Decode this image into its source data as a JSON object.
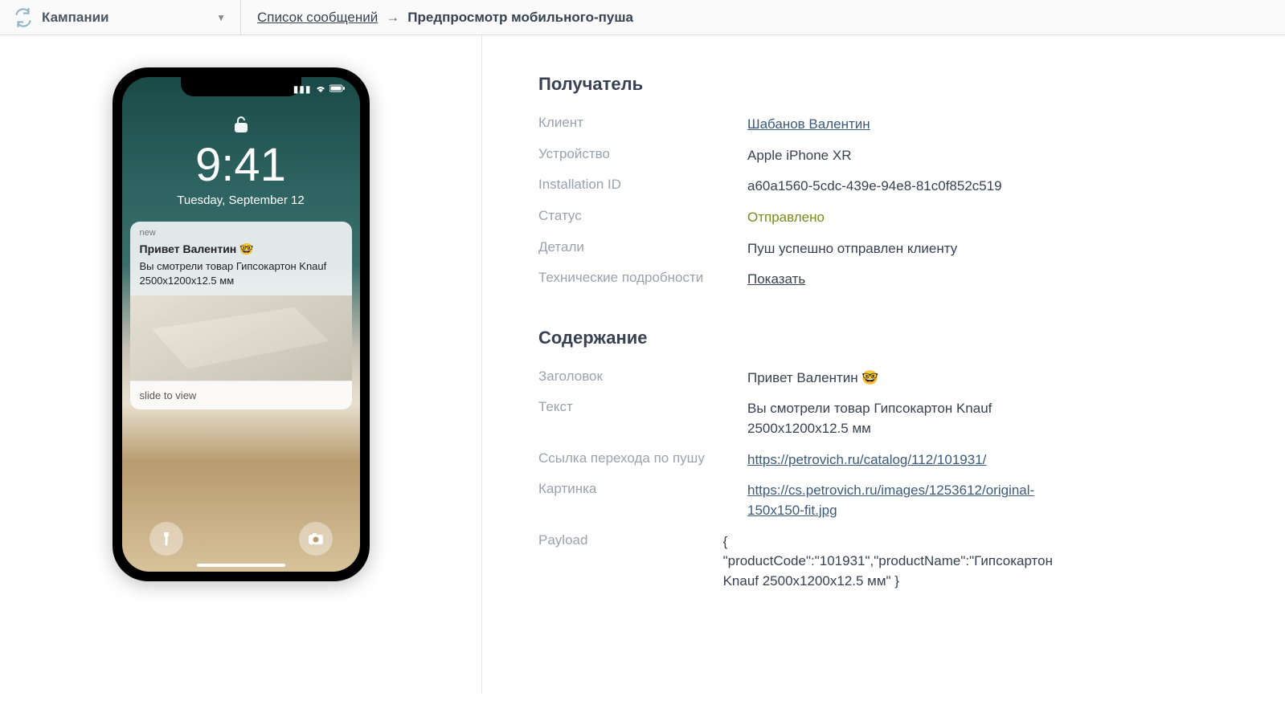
{
  "nav": {
    "brand": "Кампании",
    "breadcrumb_link": "Список сообщений",
    "breadcrumb_active": "Предпросмотр мобильного-пуша"
  },
  "phone": {
    "time": "9:41",
    "date": "Tuesday, September 12",
    "notif_app": "new",
    "notif_title": "Привет Валентин 🤓",
    "notif_body": "Вы смотрели товар Гипсокартон Knauf 2500х1200х12.5 мм",
    "slide": "slide to view"
  },
  "recipient": {
    "heading": "Получатель",
    "labels": {
      "client": "Клиент",
      "device": "Устройство",
      "install": "Installation ID",
      "status": "Статус",
      "details": "Детали",
      "tech": "Технические подробности"
    },
    "values": {
      "client": "Шабанов Валентин",
      "device": "Apple iPhone XR",
      "install": "a60a1560-5cdc-439e-94e8-81c0f852c519",
      "status": "Отправлено",
      "details": "Пуш успешно отправлен клиенту",
      "tech": "Показать"
    }
  },
  "content": {
    "heading": "Содержание",
    "labels": {
      "title": "Заголовок",
      "text": "Текст",
      "link": "Ссылка перехода по пушу",
      "image": "Картинка",
      "payload": "Payload"
    },
    "values": {
      "title": "Привет Валентин 🤓",
      "text": "Вы смотрели товар Гипсокартон Knauf 2500х1200х12.5 мм",
      "link": "https://petrovich.ru/catalog/112/101931/",
      "image": "https://cs.petrovich.ru/images/1253612/original-150x150-fit.jpg",
      "payload": "{ \"productCode\":\"101931\",\"productName\":\"Гипсокартон Knauf 2500х1200х12.5 мм\" }"
    }
  }
}
